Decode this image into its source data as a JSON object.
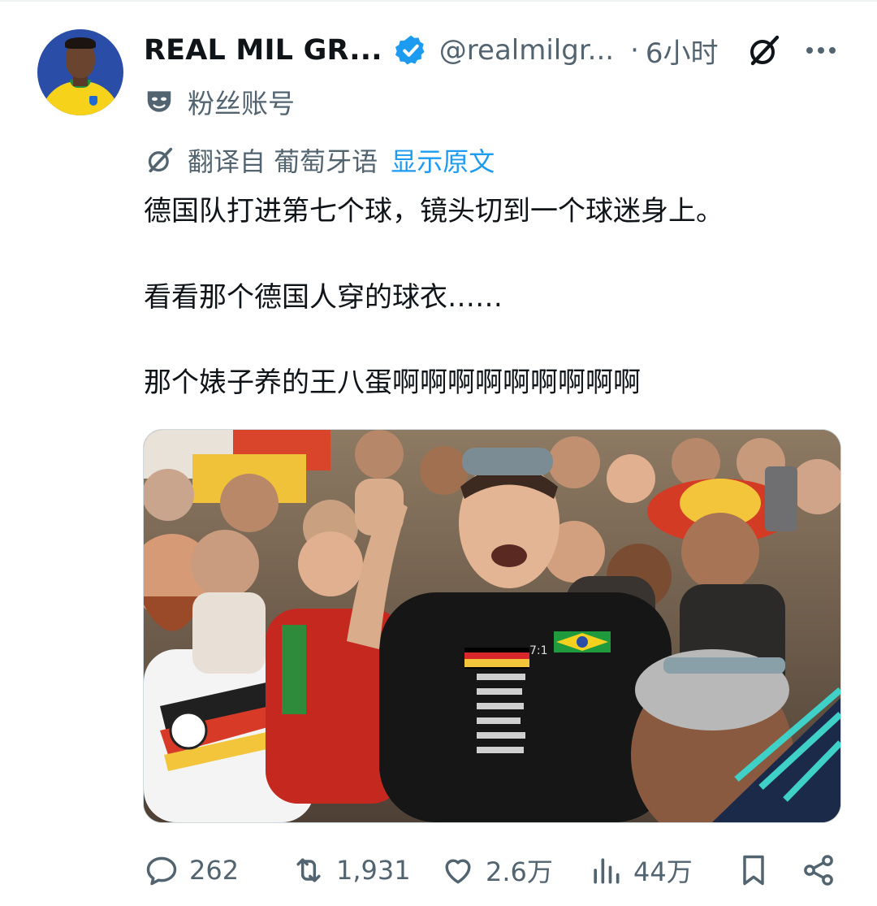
{
  "post": {
    "author_name": "REAL MIL GR...",
    "handle": "@realmilgr...",
    "separator": "·",
    "time": "6小时",
    "fan_label": "粉丝账号",
    "translated_label": "翻译自 葡萄牙语",
    "show_original": "显示原文",
    "lines": [
      "德国队打进第七个球，镜头切到一个球迷身上。",
      "看看那个德国人穿的球衣……",
      "那个婊子养的王八蛋啊啊啊啊啊啊啊啊啊"
    ],
    "shirt_score": "7:1"
  },
  "actions": {
    "replies": "262",
    "reposts": "1,931",
    "likes": "2.6万",
    "views": "44万"
  },
  "colors": {
    "text": "#0f1419",
    "secondary": "#536471",
    "accent": "#1d9bf0"
  },
  "icons": [
    "verified-badge-icon",
    "grok-icon",
    "more-icon",
    "mask-icon",
    "translate-icon",
    "reply-icon",
    "repost-icon",
    "like-icon",
    "views-icon",
    "bookmark-icon",
    "share-icon"
  ]
}
